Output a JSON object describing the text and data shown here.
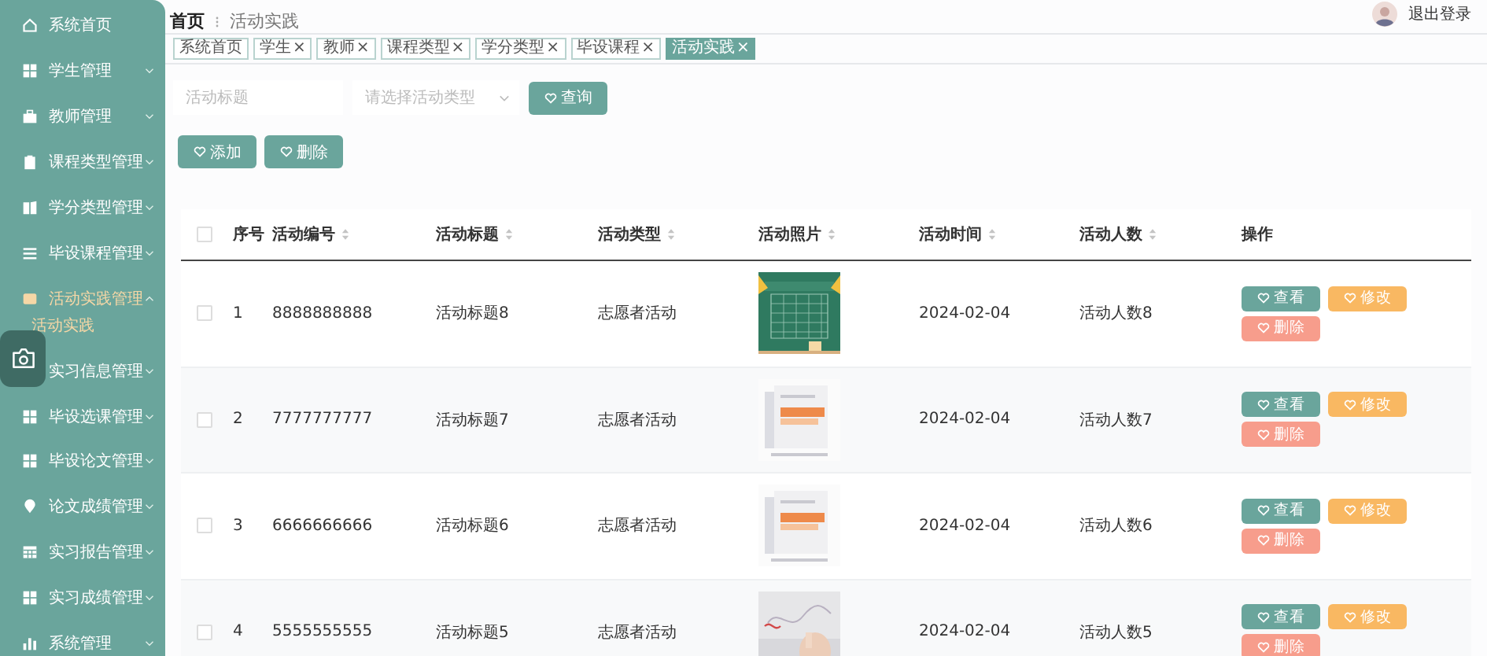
{
  "sidebar": {
    "items": [
      {
        "label": "系统首页",
        "selected": false
      },
      {
        "label": "学生管理",
        "selected": false,
        "expanded": false
      },
      {
        "label": "教师管理",
        "selected": false,
        "expanded": false
      },
      {
        "label": "课程类型管理",
        "selected": false,
        "expanded": false
      },
      {
        "label": "学分类型管理",
        "selected": false,
        "expanded": false
      },
      {
        "label": "毕设课程管理",
        "selected": false,
        "expanded": false
      },
      {
        "label": "活动实践管理",
        "selected": true,
        "expanded": true,
        "children": [
          {
            "label": "活动实践",
            "selected": true
          }
        ]
      },
      {
        "label": "实习信息管理",
        "selected": false,
        "expanded": false
      },
      {
        "label": "毕设选课管理",
        "selected": false,
        "expanded": false
      },
      {
        "label": "毕设论文管理",
        "selected": false,
        "expanded": false
      },
      {
        "label": "论文成绩管理",
        "selected": false,
        "expanded": false
      },
      {
        "label": "实习报告管理",
        "selected": false,
        "expanded": false
      },
      {
        "label": "实习成绩管理",
        "selected": false,
        "expanded": false
      },
      {
        "label": "系统管理",
        "selected": false,
        "expanded": false
      }
    ]
  },
  "header": {
    "breadcrumb": [
      "首页",
      "活动实践"
    ],
    "logout": "退出登录"
  },
  "tabs": [
    {
      "label": "系统首页",
      "selected": false
    },
    {
      "label": "学生",
      "close": "×",
      "selected": false
    },
    {
      "label": "教师",
      "close": "×",
      "selected": false
    },
    {
      "label": "课程类型",
      "close": "×",
      "selected": false
    },
    {
      "label": "学分类型",
      "close": "×",
      "selected": false
    },
    {
      "label": "毕设课程",
      "close": "×",
      "selected": false
    },
    {
      "label": "活动实践",
      "close": "×",
      "selected": true
    }
  ],
  "search": {
    "title_placeholder": "活动标题",
    "type_placeholder": "请选择活动类型",
    "query_button": "查询"
  },
  "actions": [
    "添加",
    "删除"
  ],
  "table": {
    "all_checked": false,
    "columns": [
      {
        "label": "序号",
        "sortable": false
      },
      {
        "label": "活动编号",
        "sortable": true
      },
      {
        "label": "活动标题",
        "sortable": true
      },
      {
        "label": "活动类型",
        "sortable": true
      },
      {
        "label": "活动照片",
        "sortable": true
      },
      {
        "label": "活动时间",
        "sortable": true
      },
      {
        "label": "活动人数",
        "sortable": true
      },
      {
        "label": "操作",
        "sortable": false
      }
    ],
    "rows": [
      {
        "checked": false,
        "index": "1",
        "code": "8888888888",
        "title": "活动标题8",
        "type": "志愿者活动",
        "date": "2024-02-04",
        "people": "活动人数8",
        "buttons": [
          "查看",
          "修改",
          "删除"
        ]
      },
      {
        "checked": false,
        "index": "2",
        "code": "7777777777",
        "title": "活动标题7",
        "type": "志愿者活动",
        "date": "2024-02-04",
        "people": "活动人数7",
        "buttons": [
          "查看",
          "修改",
          "删除"
        ]
      },
      {
        "checked": false,
        "index": "3",
        "code": "6666666666",
        "title": "活动标题6",
        "type": "志愿者活动",
        "date": "2024-02-04",
        "people": "活动人数6",
        "buttons": [
          "查看",
          "修改",
          "删除"
        ]
      },
      {
        "checked": false,
        "index": "4",
        "code": "5555555555",
        "title": "活动标题5",
        "type": "志愿者活动",
        "date": "2024-02-04",
        "people": "活动人数5",
        "buttons": [
          "查看",
          "修改",
          "删除"
        ]
      }
    ]
  }
}
